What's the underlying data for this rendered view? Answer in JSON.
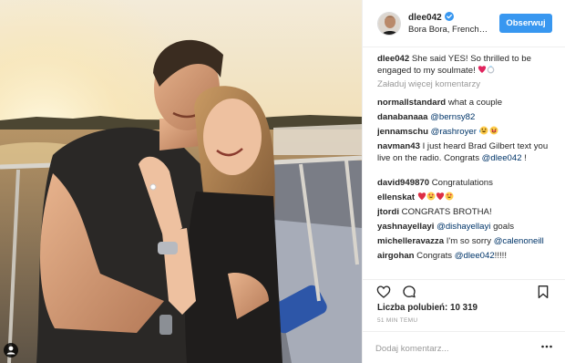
{
  "post": {
    "username": "dlee042",
    "location": "Bora Bora, French…",
    "follow_label": "Obserwuj",
    "caption_user": "dlee042",
    "caption_text": "She said YES! So thrilled to be engaged to my soulmate!",
    "load_more_label": "Załaduj więcej komentarzy",
    "likes_label": "Liczba polubień: 10 319",
    "time_label": "51 MIN TEMU",
    "add_comment_placeholder": "Dodaj komentarz..."
  },
  "comments": [
    {
      "user": "normallstandard",
      "text": " what a couple",
      "mention": ""
    },
    {
      "user": "danabanaaa",
      "text": " ",
      "mention": "@bernsy82"
    },
    {
      "user": "jennamschu",
      "text": " ",
      "mention": "@rashroyer"
    },
    {
      "user": "navman43",
      "text": " I just heard Brad Gilbert text you live on the radio. Congrats ",
      "mention": "@dlee042",
      "tail": " !"
    },
    {
      "user": "david949870",
      "text": " Congratulations",
      "mention": ""
    },
    {
      "user": "ellenskat",
      "text": " ",
      "mention": ""
    },
    {
      "user": "jtordi",
      "text": " CONGRATS BROTHA!",
      "mention": ""
    },
    {
      "user": "yashnayellayi",
      "text": " ",
      "mention": "@dishayellayi",
      "tail": " goals"
    },
    {
      "user": "michelleravazza",
      "text": " I'm so sorry ",
      "mention": "@calenoneill"
    },
    {
      "user": "airgohan",
      "text": " Congrats ",
      "mention": "@dlee042",
      "tail": "!!!!!"
    }
  ],
  "colors": {
    "accent": "#3897f0",
    "mention": "#003569",
    "muted": "#999999",
    "heart": "#ed4956"
  },
  "icons": [
    "user-tag-icon",
    "verified-badge-icon",
    "heart-icon",
    "comment-icon",
    "bookmark-icon",
    "more-options-icon"
  ]
}
